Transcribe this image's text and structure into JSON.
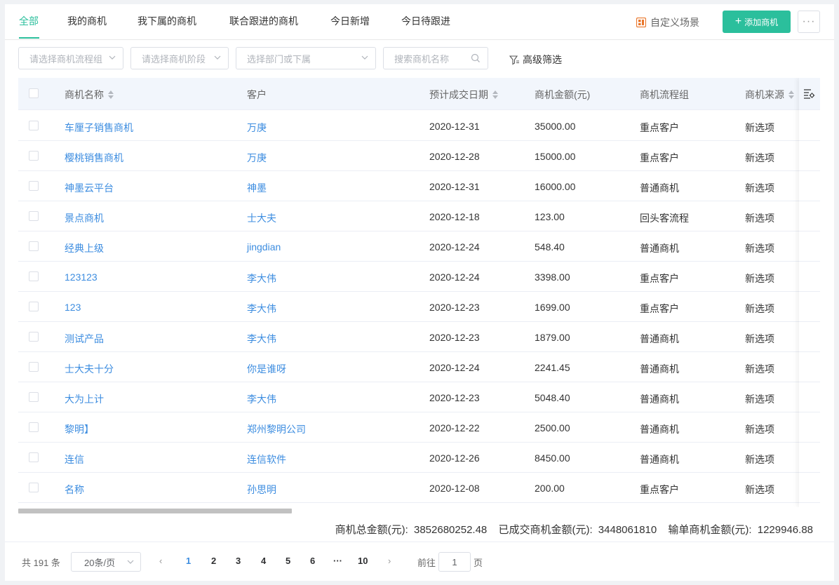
{
  "tabs": [
    {
      "label": "全部",
      "active": true
    },
    {
      "label": "我的商机"
    },
    {
      "label": "我下属的商机"
    },
    {
      "label": "联合跟进的商机"
    },
    {
      "label": "今日新增"
    },
    {
      "label": "今日待跟进"
    }
  ],
  "toolbar": {
    "custom_scene_label": "自定义场景",
    "add_label": "添加商机",
    "more_label": "···",
    "accent": "#2bbf9c"
  },
  "filters": {
    "flow_group_placeholder": "请选择商机流程组",
    "stage_placeholder": "请选择商机阶段",
    "dept_placeholder": "选择部门或下属",
    "search_placeholder": "搜索商机名称",
    "advanced_label": "高级筛选"
  },
  "table": {
    "columns": [
      "商机名称",
      "客户",
      "预计成交日期",
      "商机金额(元)",
      "商机流程组",
      "商机来源"
    ],
    "rows": [
      {
        "name": "车厘子销售商机",
        "customer": "万庚",
        "date": "2020-12-31",
        "amount": "35000.00",
        "group": "重点客户",
        "source": "新选项"
      },
      {
        "name": "樱桃销售商机",
        "customer": "万庚",
        "date": "2020-12-28",
        "amount": "15000.00",
        "group": "重点客户",
        "source": "新选项"
      },
      {
        "name": "神墨云平台",
        "customer": "神墨",
        "date": "2020-12-31",
        "amount": "16000.00",
        "group": "普通商机",
        "source": "新选项"
      },
      {
        "name": "景点商机",
        "customer": "士大夫",
        "date": "2020-12-18",
        "amount": "123.00",
        "group": "回头客流程",
        "source": "新选项"
      },
      {
        "name": "经典上级",
        "customer": "jingdian",
        "date": "2020-12-24",
        "amount": "548.40",
        "group": "普通商机",
        "source": "新选项"
      },
      {
        "name": "123123",
        "customer": "李大伟",
        "date": "2020-12-24",
        "amount": "3398.00",
        "group": "重点客户",
        "source": "新选项"
      },
      {
        "name": "123",
        "customer": "李大伟",
        "date": "2020-12-23",
        "amount": "1699.00",
        "group": "重点客户",
        "source": "新选项"
      },
      {
        "name": "测试产品",
        "customer": "李大伟",
        "date": "2020-12-23",
        "amount": "1879.00",
        "group": "普通商机",
        "source": "新选项"
      },
      {
        "name": "士大夫十分",
        "customer": "你是谁呀",
        "date": "2020-12-24",
        "amount": "2241.45",
        "group": "普通商机",
        "source": "新选项"
      },
      {
        "name": "大为上计",
        "customer": "李大伟",
        "date": "2020-12-23",
        "amount": "5048.40",
        "group": "普通商机",
        "source": "新选项"
      },
      {
        "name": "黎明】",
        "customer": "郑州黎明公司",
        "date": "2020-12-22",
        "amount": "2500.00",
        "group": "普通商机",
        "source": "新选项"
      },
      {
        "name": "连信",
        "customer": "连信软件",
        "date": "2020-12-26",
        "amount": "8450.00",
        "group": "普通商机",
        "source": "新选项"
      },
      {
        "name": "名称",
        "customer": "孙思明",
        "date": "2020-12-08",
        "amount": "200.00",
        "group": "重点客户",
        "source": "新选项"
      }
    ]
  },
  "summary": {
    "total_label": "商机总金额(元):",
    "total_value": "3852680252.48",
    "won_label": "已成交商机金额(元):",
    "won_value": "3448061810",
    "lost_label": "输单商机金额(元):",
    "lost_value": "1229946.88"
  },
  "pagination": {
    "total_text": "共 191 条",
    "page_size": "20条/页",
    "prev": "‹",
    "next": "›",
    "pages": [
      "1",
      "2",
      "3",
      "4",
      "5",
      "6"
    ],
    "ellipsis": "···",
    "last_page": "10",
    "current": "1",
    "goto_label": "前往",
    "goto_value": "1",
    "goto_unit": "页"
  }
}
